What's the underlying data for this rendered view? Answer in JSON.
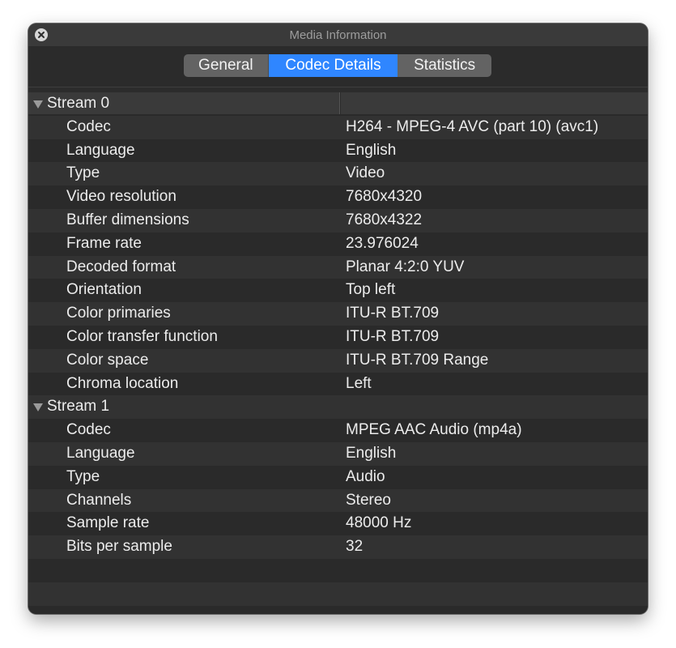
{
  "window": {
    "title": "Media Information"
  },
  "tabs": [
    {
      "label": "General",
      "selected": false
    },
    {
      "label": "Codec Details",
      "selected": true
    },
    {
      "label": "Statistics",
      "selected": false
    }
  ],
  "streams": [
    {
      "label": "Stream 0",
      "expanded": true,
      "properties": [
        {
          "key": "Codec",
          "value": "H264 - MPEG-4 AVC (part 10) (avc1)"
        },
        {
          "key": "Language",
          "value": "English"
        },
        {
          "key": "Type",
          "value": "Video"
        },
        {
          "key": "Video resolution",
          "value": "7680x4320"
        },
        {
          "key": "Buffer dimensions",
          "value": "7680x4322"
        },
        {
          "key": "Frame rate",
          "value": "23.976024"
        },
        {
          "key": "Decoded format",
          "value": "Planar 4:2:0 YUV"
        },
        {
          "key": "Orientation",
          "value": "Top left"
        },
        {
          "key": "Color primaries",
          "value": "ITU-R BT.709"
        },
        {
          "key": "Color transfer function",
          "value": "ITU-R BT.709"
        },
        {
          "key": "Color space",
          "value": "ITU-R BT.709 Range"
        },
        {
          "key": "Chroma location",
          "value": "Left"
        }
      ]
    },
    {
      "label": "Stream 1",
      "expanded": true,
      "properties": [
        {
          "key": "Codec",
          "value": "MPEG AAC Audio (mp4a)"
        },
        {
          "key": "Language",
          "value": "English"
        },
        {
          "key": "Type",
          "value": "Audio"
        },
        {
          "key": "Channels",
          "value": "Stereo"
        },
        {
          "key": "Sample rate",
          "value": "48000 Hz"
        },
        {
          "key": "Bits per sample",
          "value": "32"
        }
      ]
    }
  ],
  "colors": {
    "accent": "#2f86ff",
    "window_bg": "#2c2c2c",
    "row_stripe": "#323232"
  },
  "icons": {
    "close": "close-icon",
    "disclosure": "disclosure-triangle-icon"
  }
}
